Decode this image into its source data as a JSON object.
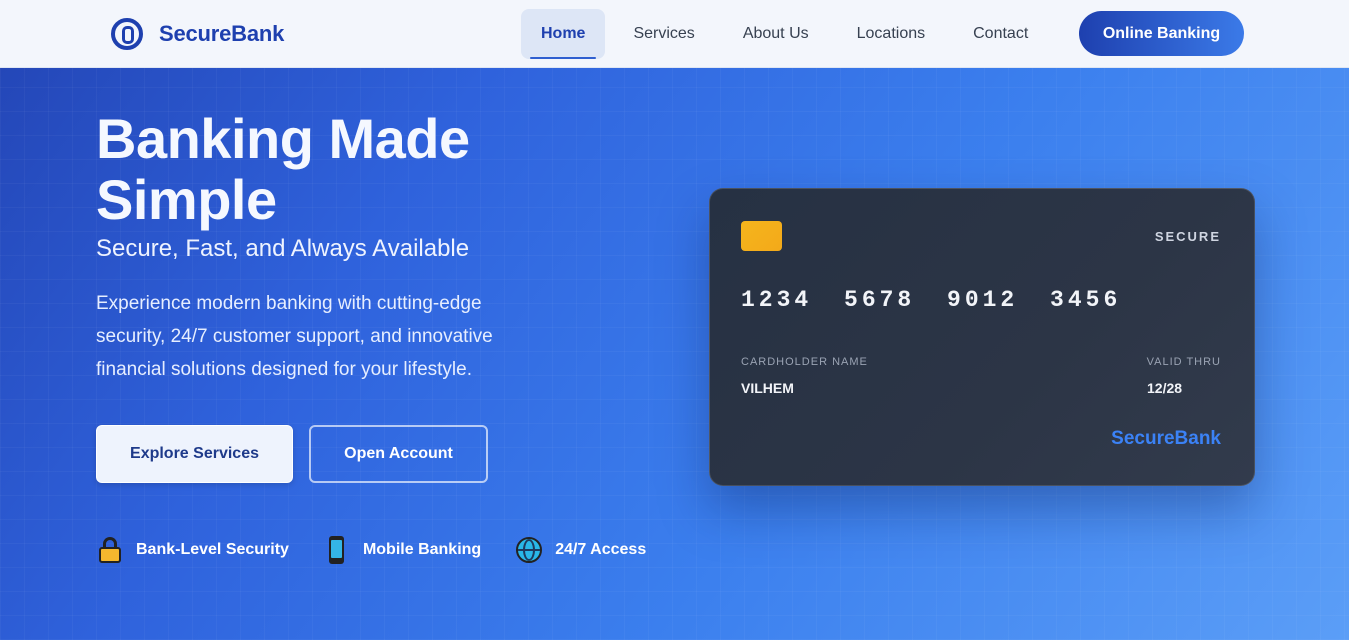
{
  "brand": {
    "name": "SecureBank",
    "icon": "circle-logo-icon"
  },
  "nav": {
    "items": [
      {
        "label": "Home",
        "active": true
      },
      {
        "label": "Services",
        "active": false
      },
      {
        "label": "About Us",
        "active": false
      },
      {
        "label": "Locations",
        "active": false
      },
      {
        "label": "Contact",
        "active": false
      }
    ],
    "cta_label": "Online Banking"
  },
  "hero": {
    "title": "Banking Made Simple",
    "subtitle": "Secure, Fast, and Always Available",
    "description": "Experience modern banking with cutting-edge security, 24/7 customer support, and innovative financial solutions designed for your lifestyle.",
    "primary_button": "Explore Services",
    "secondary_button": "Open Account"
  },
  "features": [
    {
      "icon": "lock-icon",
      "label": "Bank-Level Security"
    },
    {
      "icon": "mobile-phone-icon",
      "label": "Mobile Banking"
    },
    {
      "icon": "globe-icon",
      "label": "24/7 Access"
    }
  ],
  "card": {
    "tag": "SECURE",
    "number": "1234 5678 9012 3456",
    "holder_label": "CARDHOLDER NAME",
    "holder_name": "VILHEM",
    "valid_label": "VALID THRU",
    "valid_value": "12/28",
    "brand": "SecureBank"
  },
  "colors": {
    "brand": "#1e40af",
    "hero_start": "#2447b8",
    "hero_end": "#5b9ef7",
    "card_bg": "#2c3546",
    "chip": "#f5b51c",
    "card_brand": "#3b82f6"
  }
}
